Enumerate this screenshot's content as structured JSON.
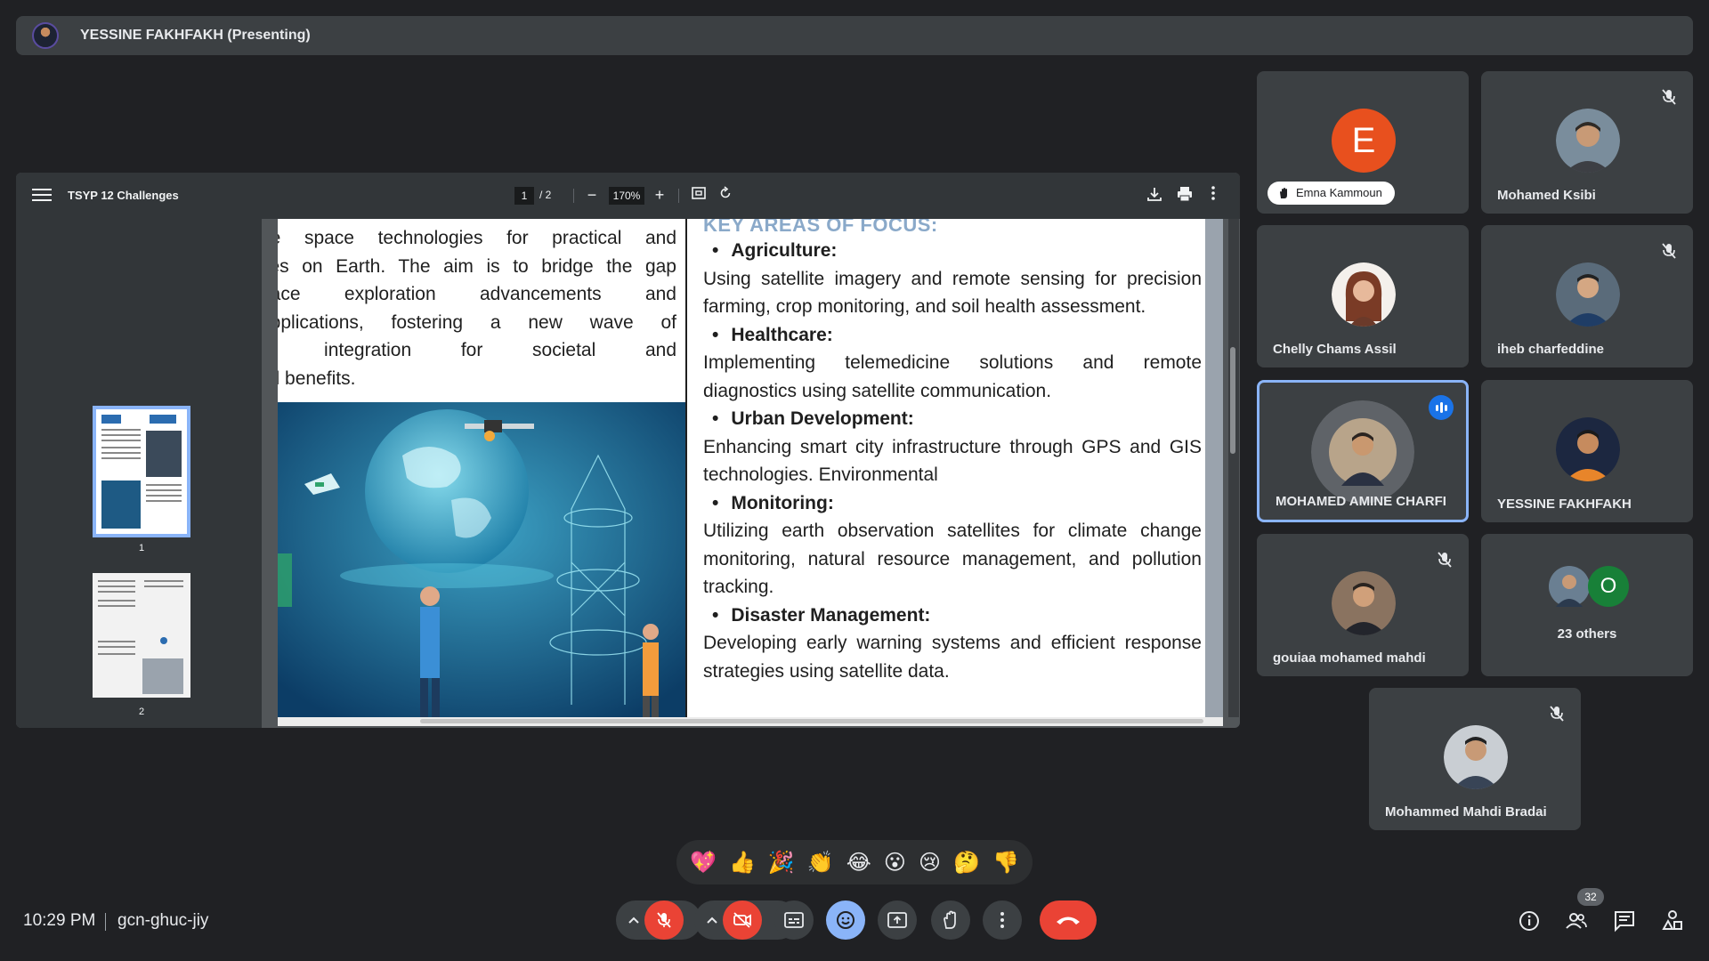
{
  "presenter_bar": {
    "name": "YESSINE FAKHFAKH (Presenting)"
  },
  "pdf": {
    "title": "TSYP 12 Challenges",
    "current_page": "1",
    "total_pages": "/  2",
    "zoom": "170%",
    "thumbnails": [
      "1",
      "2"
    ],
    "left_text": [
      "ge space technologies for practical and",
      "ses on Earth. The aim is to bridge the gap",
      "pace exploration advancements and",
      "applications, fostering a new wave of",
      "al integration for societal and",
      "tal benefits."
    ],
    "section_heading": "KEY AREAS OF FOCUS:",
    "sections": [
      {
        "title": "Agriculture:",
        "text": "Using satellite imagery and remote sensing for precision farming, crop monitoring, and soil health assessment."
      },
      {
        "title": "Healthcare:",
        "text": "Implementing telemedicine solutions and remote diagnostics using satellite communication."
      },
      {
        "title": "Urban Development:",
        "text": "Enhancing smart city infrastructure through GPS and GIS technologies. Environmental"
      },
      {
        "title": "Monitoring:",
        "text": "Utilizing earth observation satellites for climate change monitoring, natural resource management, and pollution tracking."
      },
      {
        "title": "Disaster Management:",
        "text": "Developing early warning systems and efficient response strategies using satellite data."
      }
    ]
  },
  "participants": [
    {
      "name": "Emna Kammoun",
      "avatar_letter": "E"
    },
    {
      "name": "Mohamed Ksibi"
    },
    {
      "name": "Chelly Chams Assil"
    },
    {
      "name": "iheb charfeddine"
    },
    {
      "name": "MOHAMED AMINE CHARFI"
    },
    {
      "name": "YESSINE FAKHFAKH"
    },
    {
      "name": "gouiaa mohamed mahdi"
    },
    {
      "name": "23 others",
      "avatar_letter": "O"
    },
    {
      "name": "Mohammed Mahdi Bradai"
    }
  ],
  "reactions": [
    "💖",
    "👍",
    "🎉",
    "👏",
    "😂",
    "😮",
    "😢",
    "🤔",
    "👎"
  ],
  "bottom_bar": {
    "time": "10:29 PM",
    "meeting_code": "gcn-ghuc-jiy",
    "people_count": "32"
  },
  "colors": {
    "accent_blue": "#8ab4f8",
    "danger_red": "#ea4335",
    "background": "#202124",
    "tile": "#3c4043"
  }
}
